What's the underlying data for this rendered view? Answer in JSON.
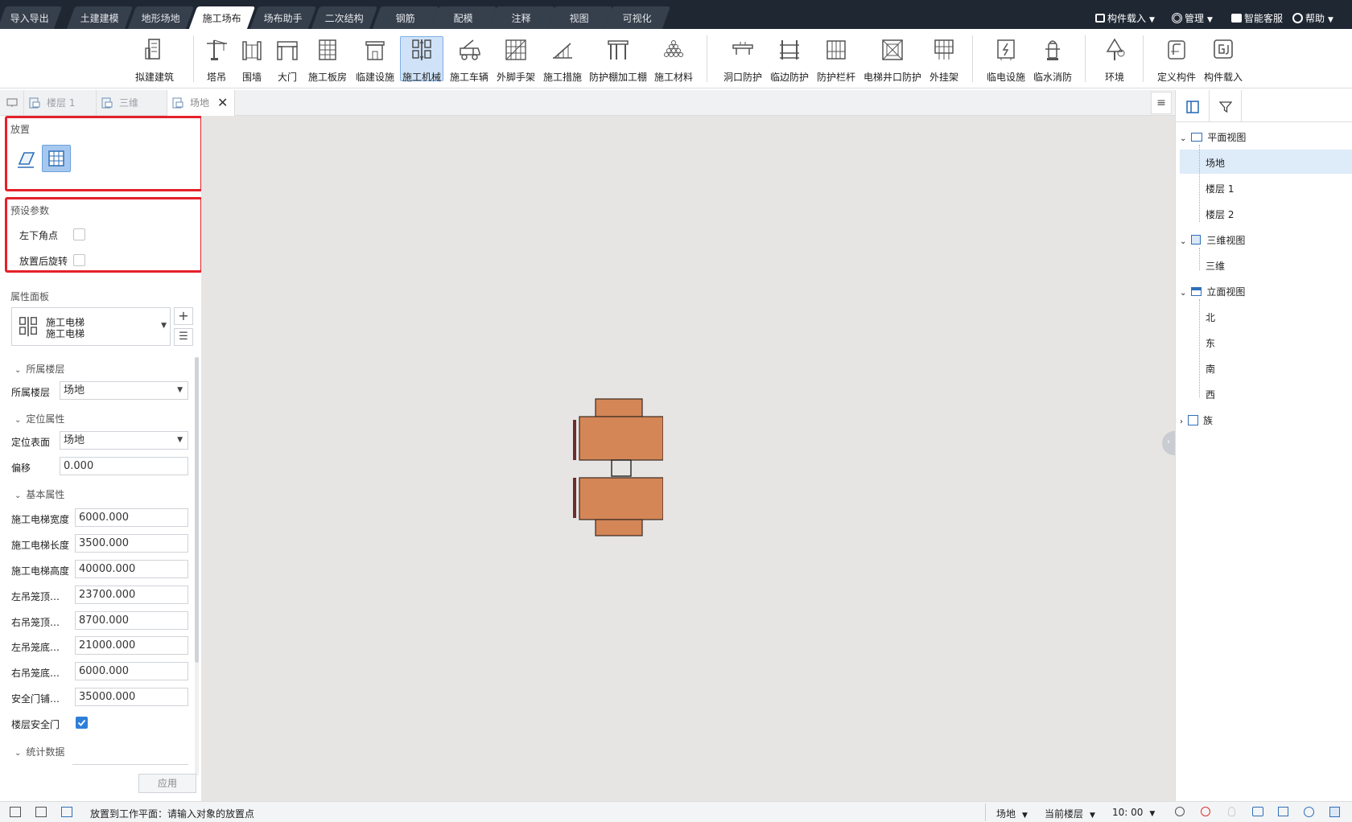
{
  "menu_tabs": [
    "导入导出",
    "土建建模",
    "地形场地",
    "施工场布",
    "场布助手",
    "二次结构",
    "钢筋",
    "配模",
    "注释",
    "视图",
    "可视化"
  ],
  "active_menu_tab": "施工场布",
  "top_right": {
    "load": "构件载入",
    "manage": "管理",
    "service": "智能客服",
    "help": "帮助"
  },
  "ribbon_tools": [
    "拟建建筑",
    "塔吊",
    "围墙",
    "大门",
    "施工板房",
    "临建设施",
    "施工机械",
    "施工车辆",
    "外脚手架",
    "施工措施",
    "防护棚加工棚",
    "施工材料",
    "洞口防护",
    "临边防护",
    "防护栏杆",
    "电梯井口防护",
    "外挂架",
    "临电设施",
    "临水消防",
    "环境",
    "定义构件",
    "构件载入"
  ],
  "active_tool": "施工机械",
  "doc_tabs": [
    "楼层 1",
    "三维",
    "场地"
  ],
  "place_section": {
    "title": "放置"
  },
  "preset": {
    "title": "预设参数",
    "opt1": "左下角点",
    "opt2": "放置后旋转"
  },
  "property_panel": {
    "title": "属性面板",
    "type_name1": "施工电梯",
    "type_name2": "施工电梯",
    "groups": {
      "floor": "所属楼层",
      "position": "定位属性",
      "basic": "基本属性",
      "stats": "统计数据"
    },
    "floor_label": "所属楼层",
    "floor_value": "场地",
    "surface_label": "定位表面",
    "surface_value": "场地",
    "offset_label": "偏移",
    "offset_value": "0.000",
    "basic_rows": [
      {
        "label": "施工电梯宽度",
        "value": "6000.000"
      },
      {
        "label": "施工电梯长度",
        "value": "3500.000"
      },
      {
        "label": "施工电梯高度",
        "value": "40000.000"
      },
      {
        "label": "左吊笼顶…",
        "value": "23700.000"
      },
      {
        "label": "右吊笼顶…",
        "value": "8700.000"
      },
      {
        "label": "左吊笼底…",
        "value": "21000.000"
      },
      {
        "label": "右吊笼底…",
        "value": "6000.000"
      },
      {
        "label": "安全门铺…",
        "value": "35000.000"
      }
    ],
    "safety_door_label": "楼层安全门",
    "apply_label": "应用"
  },
  "tree": {
    "plan": "平面视图",
    "plan_items": [
      "场地",
      "楼层 1",
      "楼层 2"
    ],
    "threed": "三维视图",
    "threed_items": [
      "三维"
    ],
    "elev": "立面视图",
    "elev_items": [
      "北",
      "东",
      "南",
      "西"
    ],
    "family": "族"
  },
  "status": {
    "message": "放置到工作平面：请输入对象的放置点",
    "floor": "场地",
    "scope": "当前楼层",
    "ratio": "10: 00"
  },
  "colors": {
    "elevator": "#d48657",
    "accent": "#2f7fd8",
    "red": "#e5212a"
  }
}
